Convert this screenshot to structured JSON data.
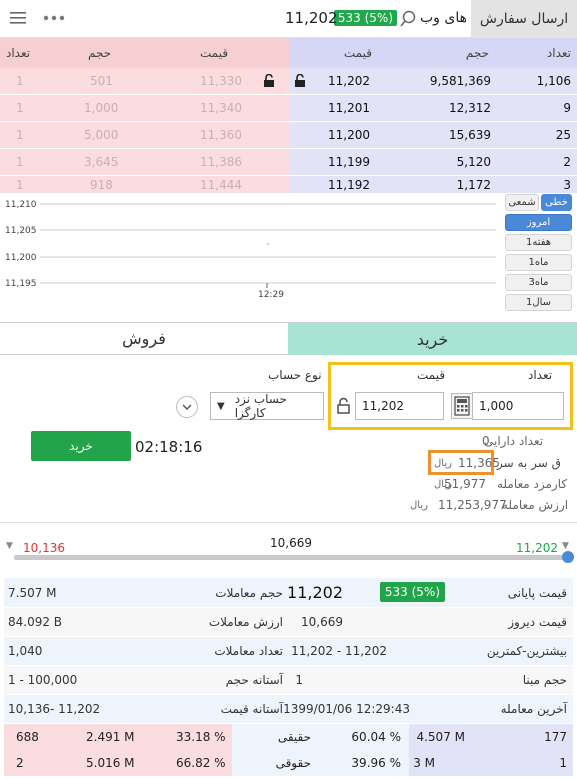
{
  "topbar": {
    "send_order": "ارسال سفارش",
    "symbol": "های وب",
    "change": "533 (5%)",
    "price": "11,202"
  },
  "orderbook": {
    "buy_headers": {
      "count": "تعداد",
      "volume": "حجم",
      "price": "قیمت"
    },
    "sell_headers": {
      "price": "قیمت",
      "volume": "حجم",
      "count": "تعداد"
    },
    "buy_rows": [
      {
        "count": "1,106",
        "volume": "9,581,369",
        "price": "11,202"
      },
      {
        "count": "9",
        "volume": "12,312",
        "price": "11,201"
      },
      {
        "count": "25",
        "volume": "15,639",
        "price": "11,200"
      },
      {
        "count": "2",
        "volume": "5,120",
        "price": "11,199"
      },
      {
        "count": "3",
        "volume": "1,172",
        "price": "11,192"
      }
    ],
    "sell_rows": [
      {
        "price": "11,330",
        "volume": "501",
        "count": "1"
      },
      {
        "price": "11,340",
        "volume": "1,000",
        "count": "1"
      },
      {
        "price": "11,360",
        "volume": "5,000",
        "count": "1"
      },
      {
        "price": "11,386",
        "volume": "3,645",
        "count": "1"
      },
      {
        "price": "11,444",
        "volume": "918",
        "count": "1"
      }
    ]
  },
  "chart": {
    "yticks": [
      "11,210",
      "11,205",
      "11,200",
      "11,195"
    ],
    "xtick": "12:29",
    "toggles": {
      "line": "خطی",
      "candle": "شمعی"
    },
    "periods": [
      "امروز",
      "1هفته",
      "1ماه",
      "3ماه",
      "1سال"
    ]
  },
  "tabs": {
    "buy": "خرید",
    "sell": "فروش"
  },
  "form": {
    "qty_label": "تعداد",
    "price_label": "قیمت",
    "account_label": "نوع حساب",
    "qty_value": "1,000",
    "price_value": "11,202",
    "account_value": "حساب نزد کارگزا",
    "buy_button": "خرید",
    "timer": "02:18:16",
    "asset_label": "تعداد دارایی",
    "asset_value": "0",
    "breakeven_label": "ق سر به سر",
    "breakeven_value": "11,365",
    "fee_label": "کارمزد معامله",
    "fee_value": "51,977",
    "value_label": "ارزش معامله",
    "value_value": "11,253,977",
    "currency": "ریال"
  },
  "slider": {
    "low": "10,136",
    "mid": "10,669",
    "high": "11,202"
  },
  "stats": {
    "last_price_label": "قیمت پایانی",
    "last_price_value": "11,202",
    "last_price_badge": "533 (5%)",
    "volume_label": "حجم معاملات",
    "volume_value": "7.507 M",
    "prev_price_label": "قیمت دیروز",
    "prev_price_value": "10,669",
    "trade_value_label": "ارزش معاملات",
    "trade_value_value": "84.092 B",
    "range_label": "بیشترین-کمترین",
    "range_value": "11,202  -  11,202",
    "trades_count_label": "تعداد معاملات",
    "trades_count_value": "1,040",
    "base_vol_label": "حجم مبنا",
    "base_vol_value": "1",
    "vol_threshold_label": "آستانه حجم",
    "vol_threshold_value": "1  -  100,000",
    "last_trade_label": "آخرین معامله",
    "last_trade_value": "1399/01/06 12:29:43",
    "price_threshold_label": "آستانه قیمت",
    "price_threshold_value": "10,136- 11,202"
  },
  "bottom_table": {
    "rows": [
      {
        "label": "حقیقی",
        "buy_count": "177",
        "buy_vol": "4.507 M",
        "buy_pct": "60.04 %",
        "sell_pct": "33.18 %",
        "sell_vol": "2.491 M",
        "sell_count": "688"
      },
      {
        "label": "حقوقی",
        "buy_count": "1",
        "buy_vol": "3 M",
        "buy_pct": "39.96 %",
        "sell_pct": "66.82 %",
        "sell_vol": "5.016 M",
        "sell_count": "2"
      }
    ]
  },
  "colors": {
    "buy_bg": "#e3e3f8",
    "sell_bg": "#fbdde0",
    "green": "#22a44a",
    "accent": "#4a88d8",
    "yellow": "#f2c31a",
    "orange": "#f0922b"
  }
}
